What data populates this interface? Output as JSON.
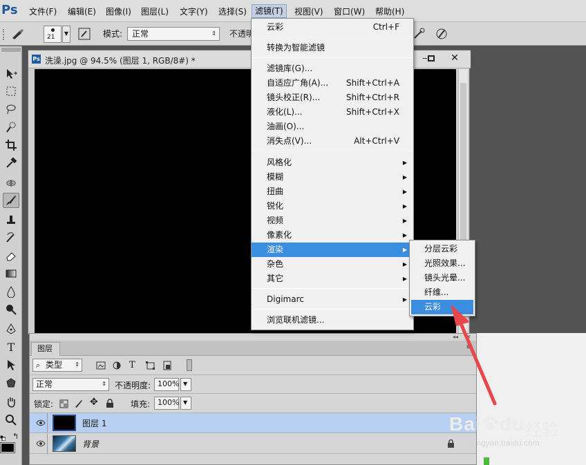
{
  "app": {
    "logo": "Ps"
  },
  "menubar": {
    "items": [
      {
        "label": "文件(F)"
      },
      {
        "label": "编辑(E)"
      },
      {
        "label": "图像(I)"
      },
      {
        "label": "图层(L)"
      },
      {
        "label": "文字(Y)"
      },
      {
        "label": "选择(S)"
      },
      {
        "label": "滤镜(T)",
        "active": true
      },
      {
        "label": "视图(V)"
      },
      {
        "label": "窗口(W)"
      },
      {
        "label": "帮助(H)"
      }
    ]
  },
  "options": {
    "brush_size": "21",
    "mode_label": "模式:",
    "mode_value": "正常",
    "opacity_label": "不透明"
  },
  "document": {
    "title": "洗澡.jpg @ 94.5% (图层 1, RGB/8#) *",
    "doc_icon": "Ps"
  },
  "filter_menu": {
    "items": [
      {
        "label": "云彩",
        "shortcut": "Ctrl+F"
      },
      {
        "label": "转换为智能滤镜"
      },
      {
        "label": "滤镜库(G)..."
      },
      {
        "label": "自适应广角(A)...",
        "shortcut": "Shift+Ctrl+A"
      },
      {
        "label": "镜头校正(R)...",
        "shortcut": "Shift+Ctrl+R"
      },
      {
        "label": "液化(L)...",
        "shortcut": "Shift+Ctrl+X"
      },
      {
        "label": "油画(O)..."
      },
      {
        "label": "消失点(V)...",
        "shortcut": "Alt+Ctrl+V"
      },
      {
        "label": "风格化"
      },
      {
        "label": "模糊"
      },
      {
        "label": "扭曲"
      },
      {
        "label": "锐化"
      },
      {
        "label": "视频"
      },
      {
        "label": "像素化"
      },
      {
        "label": "渲染",
        "highlighted": true
      },
      {
        "label": "杂色"
      },
      {
        "label": "其它"
      },
      {
        "label": "Digimarc"
      },
      {
        "label": "浏览联机滤镜..."
      }
    ],
    "arrow_glyph": "▶"
  },
  "render_submenu": {
    "items": [
      {
        "label": "分层云彩"
      },
      {
        "label": "光照效果..."
      },
      {
        "label": "镜头光晕..."
      },
      {
        "label": "纤维..."
      },
      {
        "label": "云彩",
        "highlighted": true
      }
    ]
  },
  "layers_panel": {
    "tab_label": "图层",
    "filter_kind": "类型",
    "blend_mode": "正常",
    "opacity_label": "不透明度:",
    "opacity_value": "100%",
    "lock_label": "锁定:",
    "fill_label": "填充:",
    "fill_value": "100%",
    "layers": [
      {
        "name": "图层 1",
        "selected": true
      },
      {
        "name": "背景",
        "locked": true
      }
    ]
  },
  "watermark": {
    "brand": "Bai",
    "brand2": "du",
    "jingyan": "经验",
    "url": "jingyan.baidu.com"
  },
  "colors": {
    "menu_highlight": "#3b8de0",
    "selected_layer": "#b7cff1",
    "arrow_red": "#e8484b",
    "ps_blue": "#1f5a9c"
  }
}
